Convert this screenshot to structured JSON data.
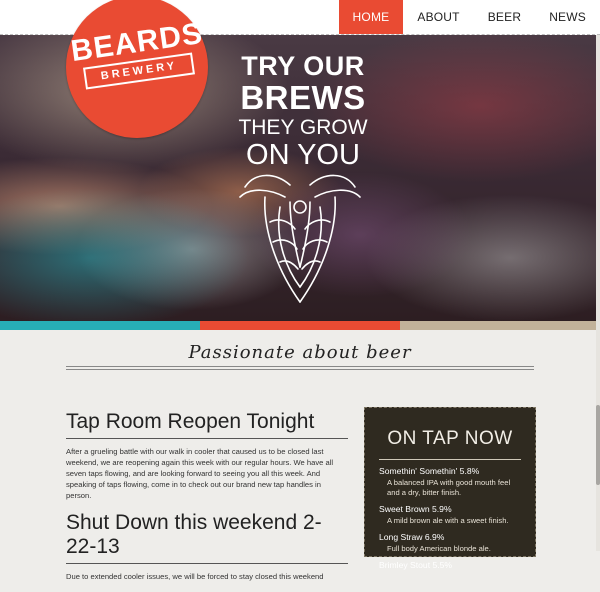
{
  "logo": {
    "name": "BEARDS",
    "sub": "BREWERY"
  },
  "nav": {
    "items": [
      {
        "label": "HOME",
        "active": true
      },
      {
        "label": "ABOUT",
        "active": false
      },
      {
        "label": "BEER",
        "active": false
      },
      {
        "label": "NEWS",
        "active": false
      }
    ]
  },
  "hero": {
    "tagline": [
      "TRY OUR",
      "BREWS",
      "THEY GROW",
      "ON YOU"
    ],
    "illustration": "bearded-hop-face"
  },
  "stripe": {
    "colors": [
      "#27aeb6",
      "#e94b33",
      "#c2b29a"
    ]
  },
  "section": {
    "heading": "Passionate about beer"
  },
  "articles": [
    {
      "title": "Tap Room Reopen Tonight",
      "body": "After a grueling battle with our walk in cooler that caused us to be closed last weekend, we are reopening again this week with our regular hours. We have all seven taps flowing, and are looking forward to seeing you all this week. And speaking of taps flowing, come in to check out our brand new tap handles in person."
    },
    {
      "title": "Shut Down this weekend 2-22-13",
      "body": "Due to extended cooler issues, we will be forced to stay closed this weekend"
    }
  ],
  "ontap": {
    "title": "ON TAP NOW",
    "beers": [
      {
        "name": "Somethin' Somethin' 5.8%",
        "desc": "A balanced IPA with good mouth feel and a dry, bitter finish."
      },
      {
        "name": "Sweet Brown 5.9%",
        "desc": "A mild brown ale with a sweet finish."
      },
      {
        "name": "Long Straw 6.9%",
        "desc": "Full body American blonde ale."
      },
      {
        "name": "Brimley Stout 5.5%",
        "desc": ""
      }
    ]
  },
  "colors": {
    "accent": "#e94b33",
    "panel": "#2f2a20"
  }
}
